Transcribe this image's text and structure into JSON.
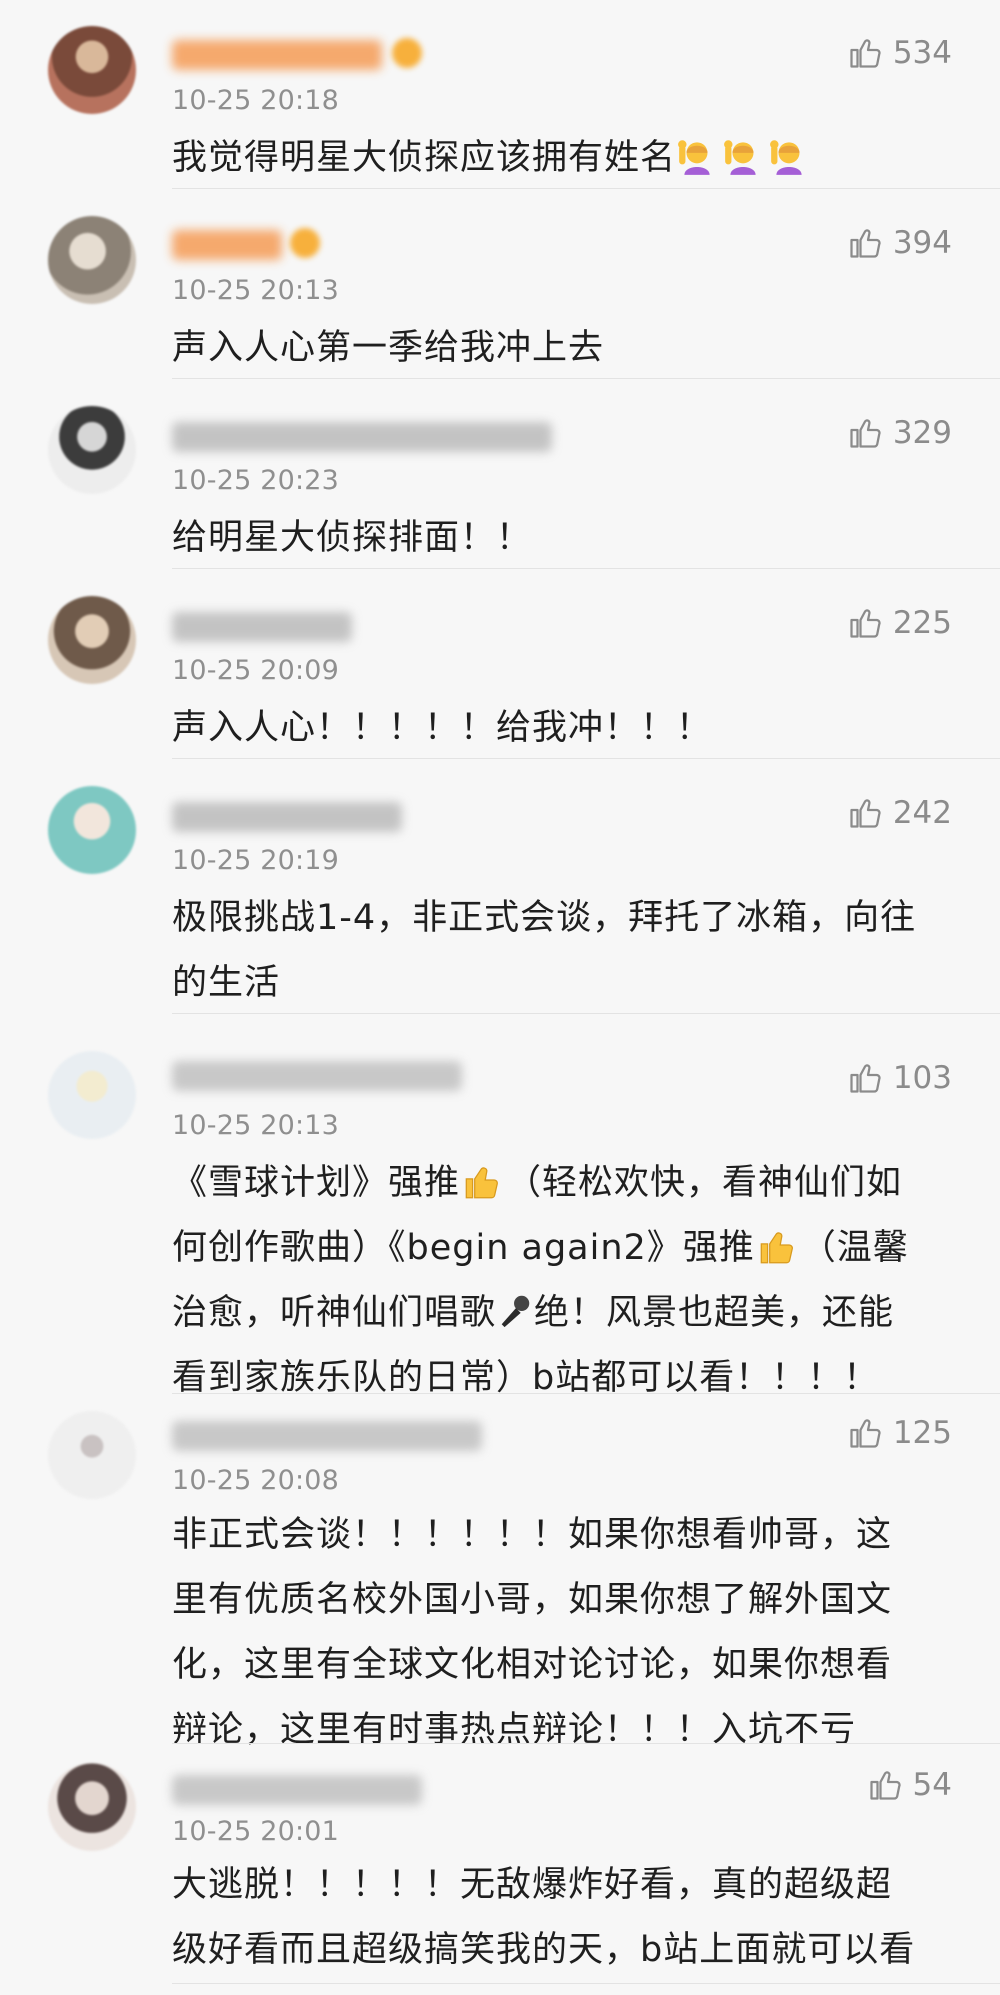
{
  "comments": [
    {
      "time": "10-25 20:18",
      "text_pre": "我觉得明星大侦探应该拥有姓名",
      "likes": "534",
      "emoji": "person-raising-hand-icon"
    },
    {
      "time": "10-25 20:13",
      "text": "声入人心第一季给我冲上去",
      "likes": "394"
    },
    {
      "time": "10-25 20:23",
      "text": "给明星大侦探排面！！",
      "likes": "329"
    },
    {
      "time": "10-25 20:09",
      "text": "声入人心！！！！！给我冲！！！",
      "likes": "225"
    },
    {
      "time": "10-25 20:19",
      "text_line1": "极限挑战1-4，非正式会谈，拜托了冰箱，向往",
      "text_line2": "的生活",
      "likes": "242"
    },
    {
      "time": "10-25 20:13",
      "segments": {
        "a": "《雪球计划》强推",
        "b": "（轻松欢快，看神仙们如",
        "c": "何创作歌曲）《begin again2》强推",
        "d": "（温馨",
        "e": "治愈，听神仙们唱歌",
        "f": "绝！风景也超美，还能",
        "g": "看到家族乐队的日常）b站都可以看！！！！"
      },
      "likes": "103",
      "emojis": [
        "thumbs-up-icon",
        "microphone-icon"
      ]
    },
    {
      "time": "10-25 20:08",
      "lines": [
        "非正式会谈！！！！！！如果你想看帅哥，这",
        "里有优质名校外国小哥，如果你想了解外国文",
        "化，这里有全球文化相对论讨论，如果你想看",
        "辩论，这里有时事热点辩论！！！入坑不亏"
      ],
      "likes": "125"
    },
    {
      "time": "10-25 20:01",
      "lines": [
        "大逃脱！！！！！无敌爆炸好看，真的超级超",
        "级好看而且超级搞笑我的天，b站上面就可以看"
      ],
      "likes": "54"
    }
  ],
  "colors": {
    "background": "#f7f7f7",
    "text": "#1f1f1f",
    "time": "#8f8f8f",
    "like": "#8b8b8b",
    "vip_name": "#f7a35c",
    "divider": "#e3e3e3"
  }
}
